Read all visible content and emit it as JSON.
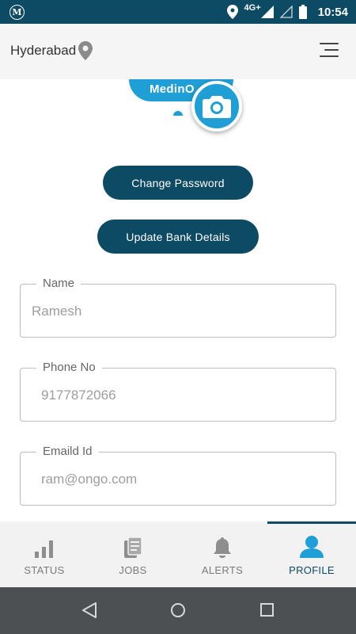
{
  "status_bar": {
    "app_icon_letter": "M",
    "network": "4G+",
    "time": "10:54"
  },
  "header": {
    "city": "Hyderabad",
    "location_icon": "location-pin-icon",
    "menu_icon": "hamburger-menu-icon"
  },
  "profile": {
    "brand_text": "MedinO",
    "camera_icon": "camera-icon"
  },
  "actions": {
    "change_password_label": "Change Password",
    "update_bank_label": "Update Bank Details"
  },
  "form": {
    "name": {
      "label": "Name",
      "value": "Ramesh"
    },
    "phone": {
      "label": "Phone No",
      "value": "9177872066"
    },
    "email": {
      "label": "Emaild Id",
      "value": "ram@ongo.com"
    }
  },
  "tabs": [
    {
      "label": "STATUS",
      "icon": "bar-chart-icon",
      "active": false
    },
    {
      "label": "JOBS",
      "icon": "documents-icon",
      "active": false
    },
    {
      "label": "ALERTS",
      "icon": "bell-icon",
      "active": false
    },
    {
      "label": "PROFILE",
      "icon": "person-icon",
      "active": true
    }
  ],
  "colors": {
    "primary_dark": "#0d4a63",
    "accent_blue": "#1f9fd6",
    "tab_inactive": "#7a7a7a",
    "nav_bar": "#4c5052"
  }
}
